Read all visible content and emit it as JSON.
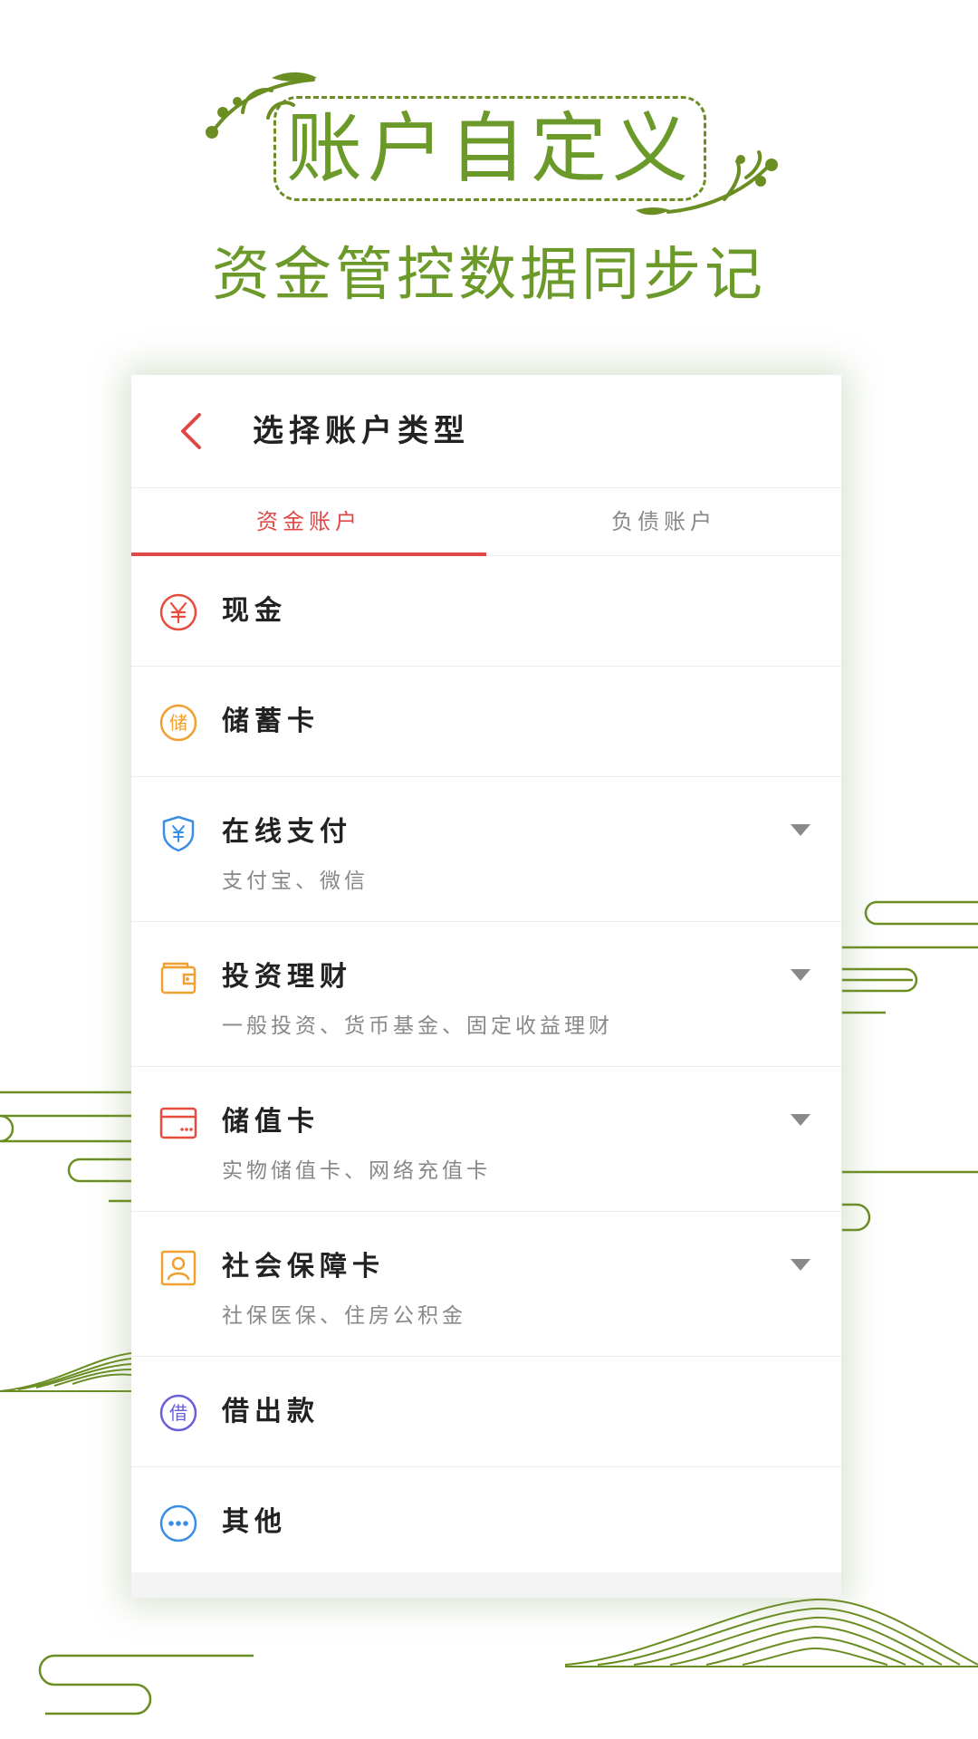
{
  "promo": {
    "title": "账户自定义",
    "subtitle": "资金管控数据同步记",
    "accent_color": "#6b9a2a"
  },
  "screen": {
    "header": {
      "back_icon": "chevron-left-icon",
      "title": "选择账户类型"
    },
    "tabs": [
      {
        "label": "资金账户",
        "active": true
      },
      {
        "label": "负债账户",
        "active": false
      }
    ],
    "items": [
      {
        "label": "现金",
        "subtitle": "",
        "icon": "yuan-circle-icon",
        "icon_color": "#e84c3d",
        "expandable": false
      },
      {
        "label": "储蓄卡",
        "subtitle": "",
        "icon": "savings-circle-icon",
        "icon_glyph": "储",
        "icon_color": "#f0a030",
        "expandable": false
      },
      {
        "label": "在线支付",
        "subtitle": "支付宝、微信",
        "icon": "yuan-shield-icon",
        "icon_color": "#3a8ee6",
        "expandable": true
      },
      {
        "label": "投资理财",
        "subtitle": "一般投资、货币基金、固定收益理财",
        "icon": "wallet-icon",
        "icon_color": "#f0a030",
        "expandable": true
      },
      {
        "label": "储值卡",
        "subtitle": "实物储值卡、网络充值卡",
        "icon": "card-icon",
        "icon_color": "#e84c3d",
        "expandable": true
      },
      {
        "label": "社会保障卡",
        "subtitle": "社保医保、住房公积金",
        "icon": "person-card-icon",
        "icon_color": "#f0a030",
        "expandable": true
      },
      {
        "label": "借出款",
        "subtitle": "",
        "icon": "loan-circle-icon",
        "icon_glyph": "借",
        "icon_color": "#6a5fd8",
        "expandable": false
      },
      {
        "label": "其他",
        "subtitle": "",
        "icon": "more-circle-icon",
        "icon_color": "#3a8ee6",
        "expandable": false
      }
    ],
    "accent_color": "#e04848"
  }
}
